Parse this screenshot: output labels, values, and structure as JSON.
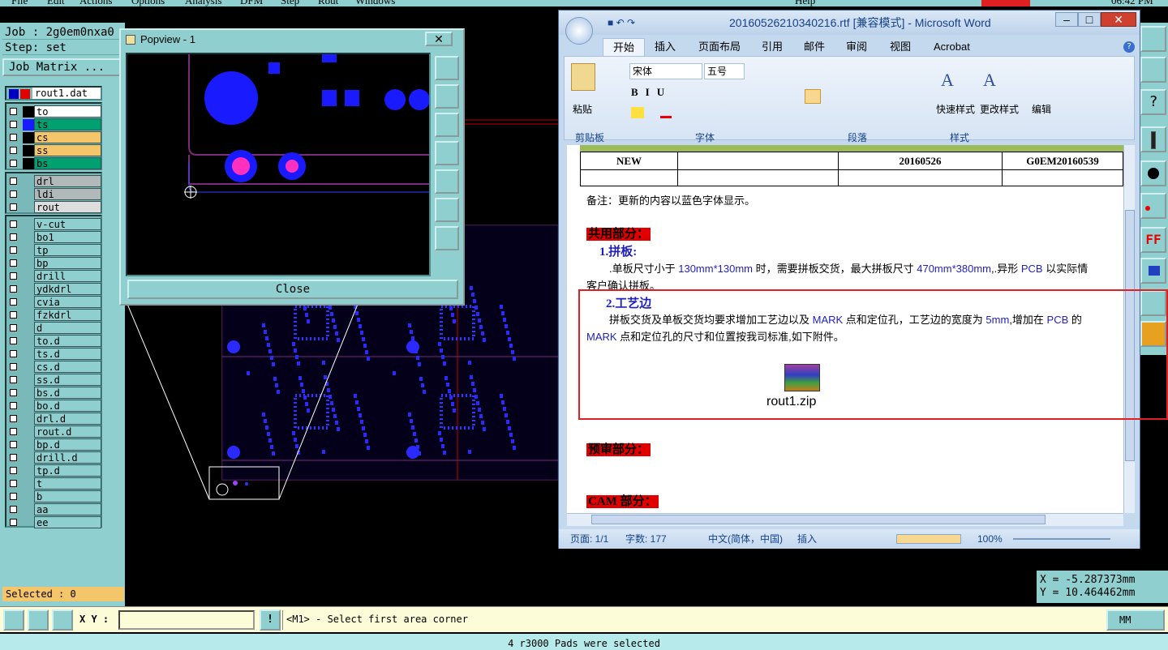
{
  "menubar": {
    "items": [
      "File",
      "Edit",
      "Actions",
      "Options",
      "Analysis",
      "DFM",
      "Step",
      "Rout",
      "Windows"
    ],
    "help": "Help",
    "clock": "06:42 PM"
  },
  "job": {
    "job_label": "Job : 2g0em0nxa0",
    "step_label": "Step: set",
    "matrix_button": "Job Matrix ..."
  },
  "layers": {
    "current": "rout1.dat",
    "group1": [
      {
        "name": "to",
        "color": "#ffffff",
        "swatch": "#000000"
      },
      {
        "name": "ts",
        "color": "#00a070",
        "swatch": "#1a1aff"
      },
      {
        "name": "cs",
        "color": "#f5c56a",
        "swatch": "#000000"
      },
      {
        "name": "ss",
        "color": "#f5c56a",
        "swatch": "#000000"
      },
      {
        "name": "bs",
        "color": "#00a070",
        "swatch": "#000000"
      }
    ],
    "group2": [
      {
        "name": "drl",
        "color": "#b0b8b8"
      },
      {
        "name": "ldi",
        "color": "#b0b8b8"
      },
      {
        "name": "rout",
        "color": "#dddddd"
      }
    ],
    "group3": [
      "v-cut",
      "bo1",
      "tp",
      "bp",
      "drill",
      "ydkdrl",
      "cvia",
      "fzkdrl",
      "d",
      "to.d",
      "ts.d",
      "cs.d",
      "ss.d",
      "bs.d",
      "bo.d",
      "drl.d",
      "rout.d",
      "bp.d",
      "drill.d",
      "tp.d",
      "t",
      "b",
      "aa",
      "ee"
    ]
  },
  "selected": "Selected : 0",
  "popview": {
    "title": "Popview - 1",
    "close_label": "Close"
  },
  "coords": {
    "x": "X = -5.287373mm",
    "y": "Y = 10.464462mm"
  },
  "cmdbar": {
    "xy_label": "X Y :",
    "xy_value": "",
    "prompt": "<M1> - Select first area corner",
    "units": "MM"
  },
  "status": "4 r3000 Pads were selected",
  "word": {
    "title": "20160526210340216.rtf [兼容模式] - Microsoft Word",
    "tabs": [
      "开始",
      "插入",
      "页面布局",
      "引用",
      "邮件",
      "审阅",
      "视图",
      "Acrobat"
    ],
    "font_name": "宋体",
    "font_size": "五号",
    "groups": [
      "剪贴板",
      "字体",
      "段落",
      "样式",
      "编辑"
    ],
    "paste": "粘贴",
    "quick_style": "快速样式",
    "change_style": "更改样式",
    "edit": "编辑",
    "table_row": [
      "NEW",
      "",
      "20160526",
      "G0EM20160539"
    ],
    "note": "备注：更新的内容以蓝色字体显示。",
    "sec_common": "共用部分：",
    "item1_title": "1.拼板:",
    "item1_line1a": ".单板尺寸小于 ",
    "item1_line1b": "130mm*130mm",
    "item1_line1c": " 时，需要拼板交货，最大拼板尺寸 ",
    "item1_line1d": "470mm*380mm",
    "item1_line1e": ",.异形 ",
    "item1_line1f": "PCB",
    "item1_line1g": " 以实际情",
    "item1_line2": "客户确认拼板。",
    "item2_title": "2.工艺边",
    "item2_line1a": "拼板交货及单板交货均要求增加工艺边以及 ",
    "item2_line1b": "MARK",
    "item2_line1c": " 点和定位孔，工艺边的宽度为 ",
    "item2_line1d": "5mm",
    "item2_line1e": ",增加在 ",
    "item2_line1f": "PCB",
    "item2_line1g": " 的",
    "item2_line2a": "MARK",
    "item2_line2b": " 点和定位孔的尺寸和位置按我司标准,如下附件。",
    "attachment": "rout1.zip",
    "sec_pre": "预审部分：",
    "sec_cam": "CAM 部分：",
    "status_page": "页面: 1/1",
    "status_words": "字数: 177",
    "status_lang": "中文(简体，中国)",
    "status_mode": "插入",
    "zoom": "100%"
  }
}
